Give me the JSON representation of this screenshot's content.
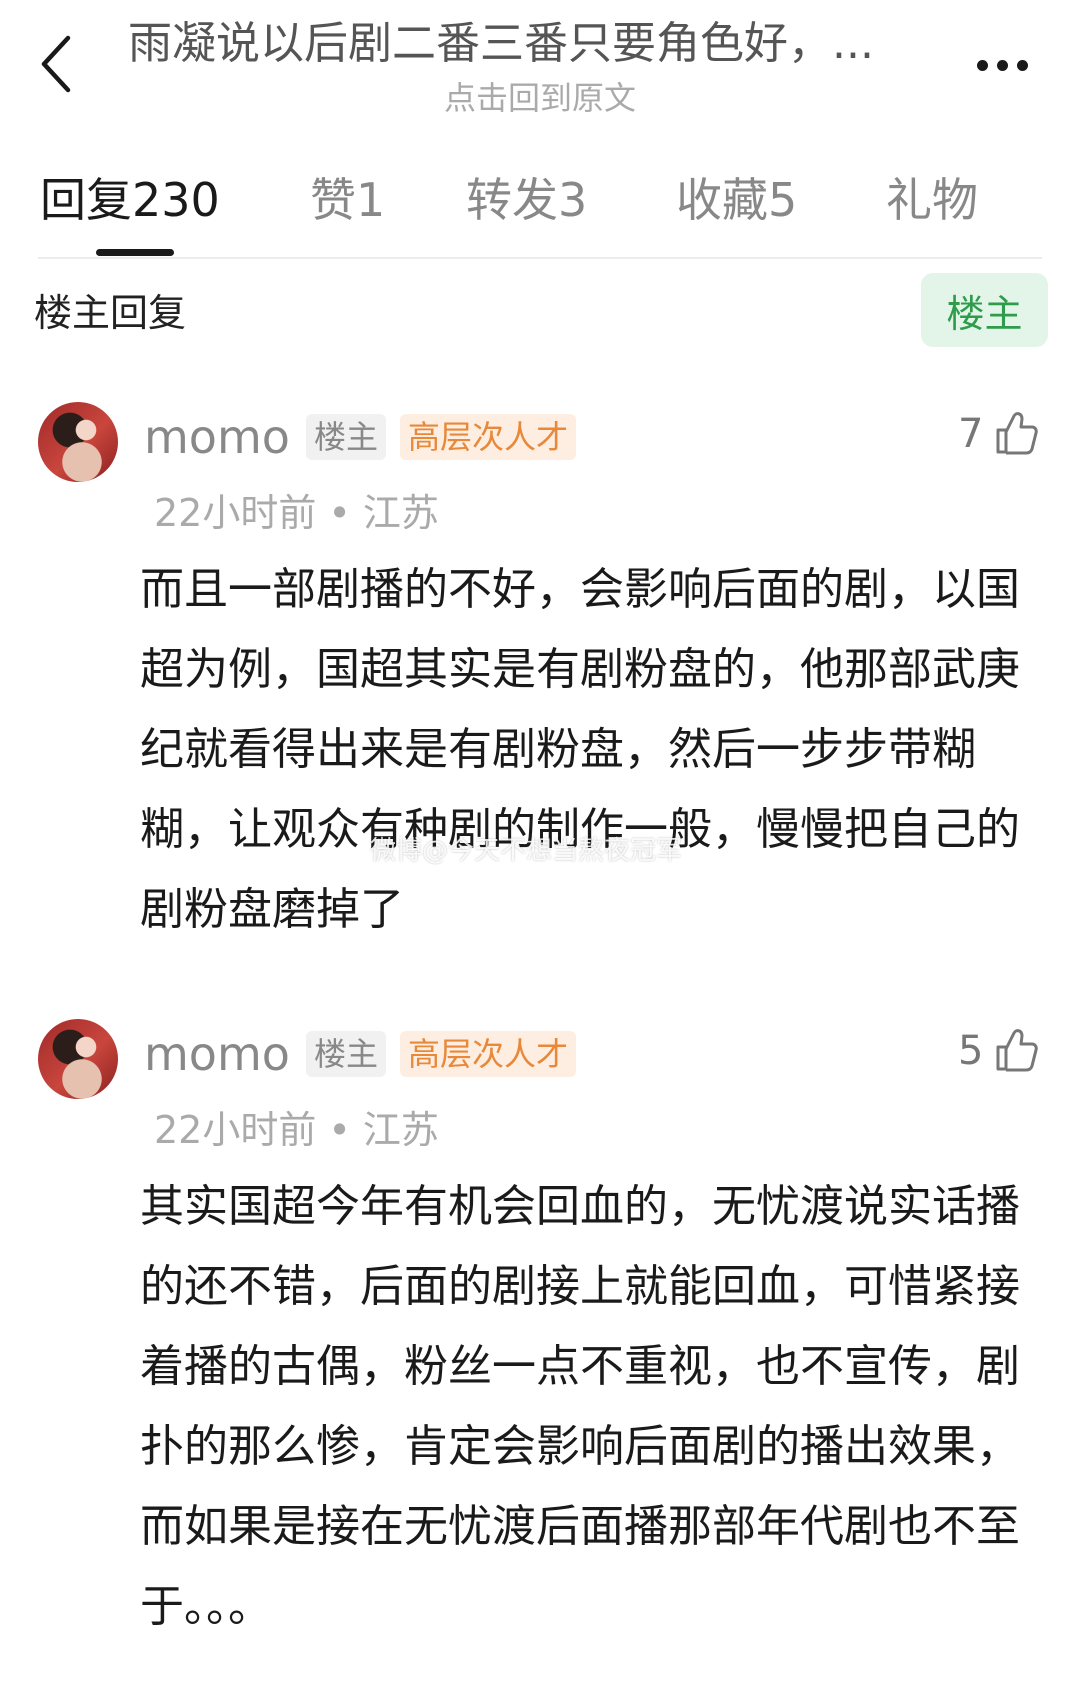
{
  "header": {
    "title": "雨凝说以后剧二番三番只要角色好，...",
    "subtitle": "点击回到原文"
  },
  "tabs": [
    {
      "label": "回复230"
    },
    {
      "label": "赞1"
    },
    {
      "label": "转发3"
    },
    {
      "label": "收藏5"
    },
    {
      "label": "礼物"
    }
  ],
  "section": {
    "title": "楼主回复",
    "filter_label": "楼主"
  },
  "comments": [
    {
      "username": "momo",
      "host_badge": "楼主",
      "rank_badge": "高层次人才",
      "likes": "7",
      "meta": "22小时前 • 江苏",
      "content": "而且一部剧播的不好，会影响后面的剧，以国超为例，国超其实是有剧粉盘的，他那部武庚纪就看得出来是有剧粉盘，然后一步步带糊糊，让观众有种剧的制作一般，慢慢把自己的剧粉盘磨掉了"
    },
    {
      "username": "momo",
      "host_badge": "楼主",
      "rank_badge": "高层次人才",
      "likes": "5",
      "meta": "22小时前 • 江苏",
      "content": "其实国超今年有机会回血的，无忧渡说实话播的还不错，后面的剧接上就能回血，可惜紧接着播的古偶，粉丝一点不重视，也不宣传，剧扑的那么惨，肯定会影响后面剧的播出效果，而如果是接在无忧渡后面播那部年代剧也不至于。。。"
    }
  ],
  "watermark": "微博@今天不想当熬夜冠军",
  "colors": {
    "host_filter_bg": "#e3f5e8",
    "host_filter_text": "#2f9c4c",
    "rank_badge_bg": "#fdeee1",
    "rank_badge_text": "#e8893a"
  }
}
